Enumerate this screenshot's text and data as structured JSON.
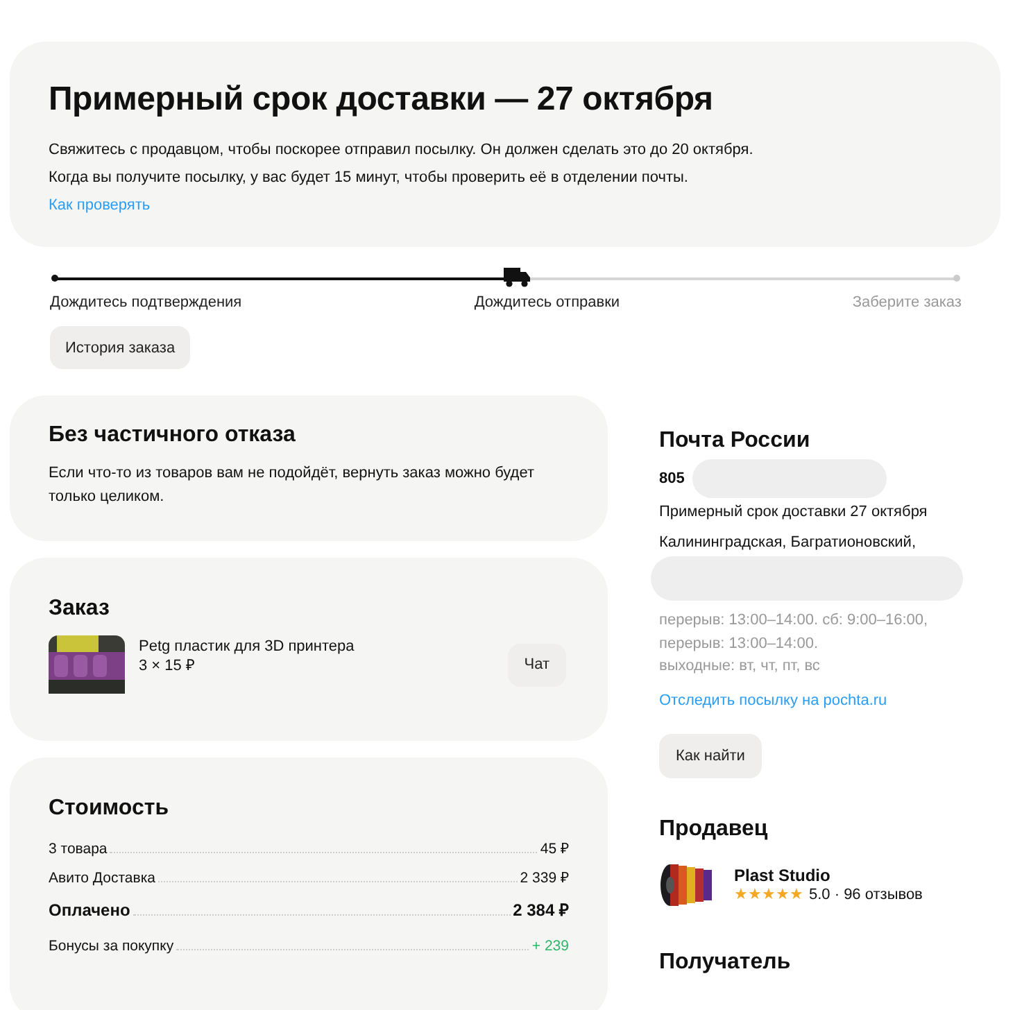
{
  "delivery": {
    "title": "Примерный срок доставки — 27 октября",
    "lines": [
      "Свяжитесь с продавцом, чтобы поскорее отправил посылку. Он должен сделать это до 20 октября.",
      "Когда вы получите посылку, у вас будет 15 минут, чтобы проверить её в отделении почты."
    ],
    "link": "Как проверять"
  },
  "progress": {
    "level": 0.5,
    "steps": [
      {
        "label": "Дождитесь подтверждения",
        "disabled": false
      },
      {
        "label": "Дождитесь отправки",
        "disabled": false
      },
      {
        "label": "Заберите заказ",
        "disabled": true
      }
    ]
  },
  "history_button": "История заказа",
  "no_partial": {
    "title": "Без частичного отказа",
    "text": "Если что-то из товаров вам не подойдёт, вернуть заказ можно будет только целиком."
  },
  "order": {
    "title": "Заказ",
    "items": [
      {
        "kind": "picture",
        "name": "Petg пластик для 3D принтера",
        "price": "3 × 15 ₽",
        "button": "Чат"
      }
    ]
  },
  "cost": {
    "title": "Стоимость",
    "rows": [
      {
        "kind": "normal",
        "label": "3 товара",
        "value": "45 ₽"
      },
      {
        "kind": "normal",
        "label": "Авито Доставка",
        "value": "2 339 ₽"
      },
      {
        "kind": "total",
        "label": "Оплачено",
        "value": "2 384 ₽"
      },
      {
        "kind": "bonus",
        "label": "Бонусы за покупку",
        "value": "+ 239"
      }
    ]
  },
  "post": {
    "title": "Почта России",
    "code": "805",
    "eta": "Примерный срок доставки 27 октября",
    "address": "Калининградская, Багратионовский,",
    "hours": [
      "перерыв: 13:00–14:00. сб: 9:00–16:00,",
      "перерыв: 13:00–14:00.",
      "выходные: вт, чт, пт, вс"
    ],
    "track_link": "Отследить посылку на pochta.ru",
    "button": "Как найти"
  },
  "seller": {
    "title": "Продавец",
    "name": "Plast Studio",
    "stars": 5,
    "rating": "5.0 · 96 отзывов"
  },
  "recipient": {
    "title": "Получатель"
  }
}
